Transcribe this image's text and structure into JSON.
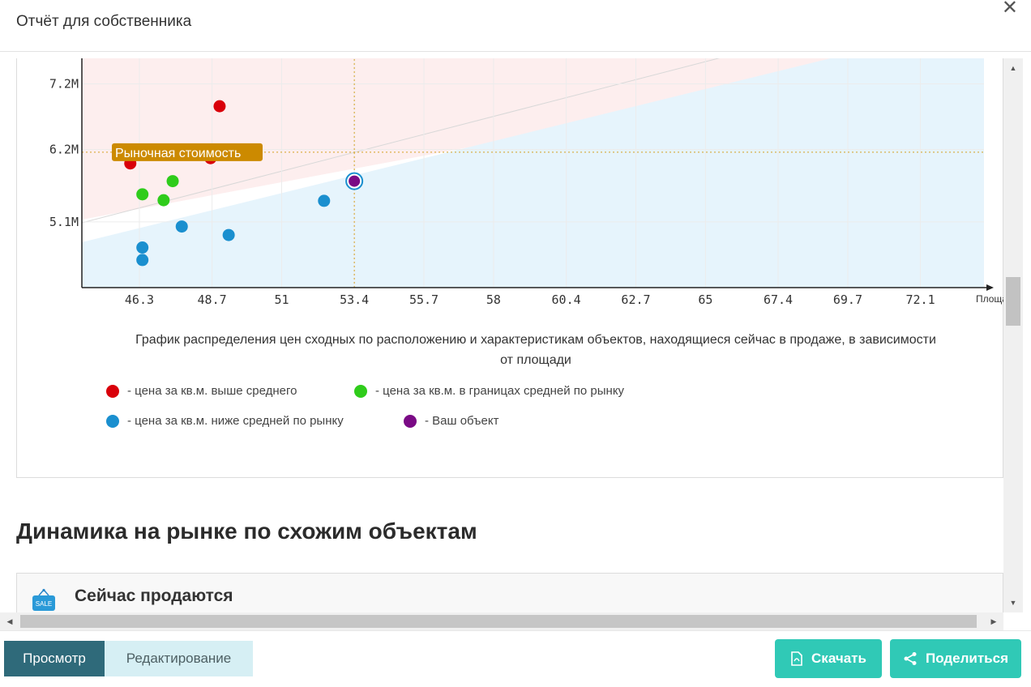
{
  "modal": {
    "title": "Отчёт для собственника",
    "close_glyph": "✕"
  },
  "chart_data": {
    "type": "scatter",
    "title": "",
    "xlabel": "Площадь",
    "ylabel": "",
    "x_ticks": [
      "46.3",
      "48.7",
      "51",
      "53.4",
      "55.7",
      "58",
      "60.4",
      "62.7",
      "65",
      "67.4",
      "69.7",
      "72.1"
    ],
    "y_ticks": [
      "7.2M",
      "6.2M",
      "5.1M"
    ],
    "xlim": [
      44.4,
      74.2
    ],
    "ylim": [
      4.1,
      7.7
    ],
    "market_value_label": "Рыночная стоимость",
    "market_value_y": 6.16,
    "your_object_x": 53.4,
    "series": [
      {
        "key": "above",
        "color": "#d9000a",
        "points": [
          [
            48.95,
            6.86
          ],
          [
            49.25,
            6.2
          ],
          [
            48.65,
            6.07
          ],
          [
            46.0,
            5.99
          ]
        ]
      },
      {
        "key": "within",
        "color": "#2fcc1b",
        "points": [
          [
            47.4,
            5.72
          ],
          [
            46.4,
            5.52
          ],
          [
            47.1,
            5.43
          ]
        ]
      },
      {
        "key": "below",
        "color": "#1a8fcf",
        "points": [
          [
            52.4,
            5.42
          ],
          [
            47.7,
            5.03
          ],
          [
            49.25,
            4.9
          ],
          [
            46.4,
            4.71
          ],
          [
            46.4,
            4.52
          ]
        ]
      },
      {
        "key": "yours",
        "color": "#7a0a85",
        "points": [
          [
            53.4,
            5.72
          ]
        ]
      }
    ]
  },
  "caption": "График распределения цен сходных по расположению и характеристикам объектов, находящиеся сейчас в продаже, в зависимости от площади",
  "legend": [
    {
      "label": "- цена за кв.м. выше среднего",
      "color": "#d9000a"
    },
    {
      "label": "- цена за кв.м. в границах средней по рынку",
      "color": "#2fcc1b"
    },
    {
      "label": "- цена за кв.м. ниже средней по рынку",
      "color": "#1a8fcf"
    },
    {
      "label": "- Ваш объект",
      "color": "#7a0a85"
    }
  ],
  "section_heading": "Динамика на рынке по схожим объектам",
  "selling_card": {
    "title": "Сейчас продаются",
    "icon_text": "SALE"
  },
  "footer": {
    "view_tab": "Просмотр",
    "edit_tab": "Редактирование",
    "download_btn": "Скачать",
    "share_btn": "Поделиться"
  },
  "colors": {
    "accent": "#30c9b6",
    "tab_active": "#2f6a7a",
    "tab_inactive": "#d6eff4",
    "label_bg": "#cc8a00"
  }
}
